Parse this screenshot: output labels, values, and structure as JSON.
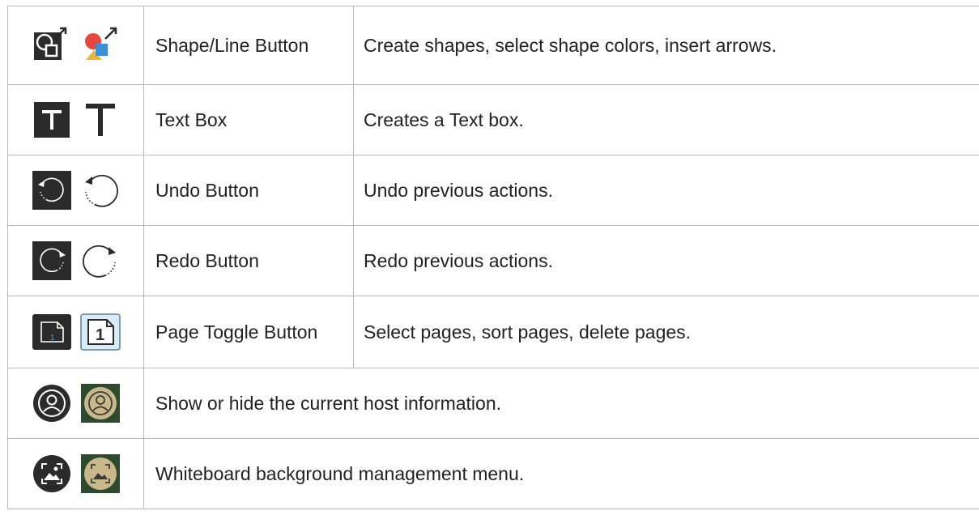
{
  "rows": [
    {
      "icons": [
        "shape-dark-icon",
        "shape-color-icon"
      ],
      "name": "Shape/Line Button",
      "description": "Create shapes, select shape colors, insert arrows."
    },
    {
      "icons": [
        "text-dark-icon",
        "text-light-icon"
      ],
      "name": "Text Box",
      "description": "Creates a Text box."
    },
    {
      "icons": [
        "undo-dark-icon",
        "undo-light-icon"
      ],
      "name": "Undo Button",
      "description": "Undo previous actions."
    },
    {
      "icons": [
        "redo-dark-icon",
        "redo-light-icon"
      ],
      "name": "Redo Button",
      "description": "Redo previous actions."
    },
    {
      "icons": [
        "page-dark-icon",
        "page-light-icon"
      ],
      "name": "Page Toggle Button",
      "description": "Select pages, sort pages, delete pages.",
      "page_number": "1"
    },
    {
      "icons": [
        "host-dark-icon",
        "host-active-icon"
      ],
      "description": "Show or hide the current host information."
    },
    {
      "icons": [
        "background-dark-icon",
        "background-active-icon"
      ],
      "description": "Whiteboard background management menu."
    }
  ],
  "colors": {
    "border": "#b8b8b8",
    "icon_dark": "#2b2b2b",
    "active_bg": "#2d4a2f",
    "active_circle": "#c9b88a",
    "shape_red": "#e8473b",
    "shape_blue": "#3a8fd6",
    "shape_yellow": "#f2b531",
    "page_light_bg": "#d7ecf7"
  }
}
